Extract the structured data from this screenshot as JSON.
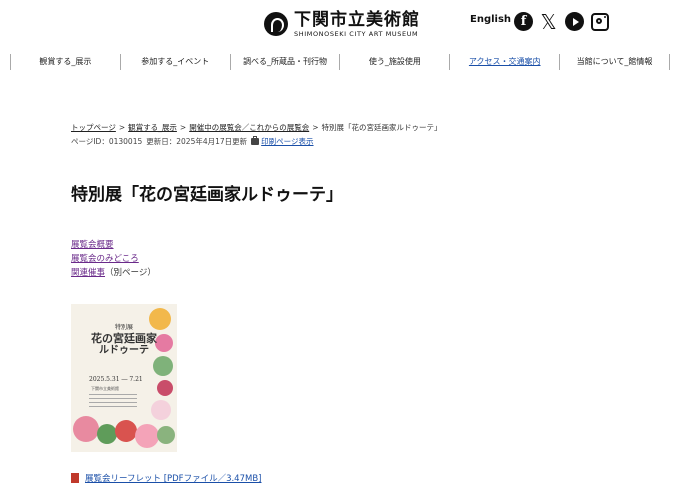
{
  "header": {
    "logo_jp": "下関市立美術館",
    "logo_en": "SHIMONOSEKI CITY ART MUSEUM",
    "language_link": "English",
    "social": [
      "facebook-icon",
      "x-icon",
      "youtube-icon",
      "instagram-icon"
    ]
  },
  "nav": {
    "items": [
      {
        "label": "観賞する_展示"
      },
      {
        "label": "参加する_イベント"
      },
      {
        "label": "調べる_所蔵品・刊行物"
      },
      {
        "label": "使う_施設使用"
      },
      {
        "label": "アクセス・交通案内"
      },
      {
        "label": "当館について_館情報"
      }
    ],
    "active_color": "#1a4fa8"
  },
  "breadcrumb": {
    "items": [
      "トップページ",
      "観賞する_展示",
      "開催中の展覧会／これからの展覧会"
    ],
    "current": "特別展「花の宮廷画家ルドゥーテ」",
    "separator": ">"
  },
  "meta": {
    "page_id": "ページID：0130015",
    "updated": "更新日：2025年4月17日更新",
    "print_label": "印刷ページ表示"
  },
  "page_title": "特別展「花の宮廷画家ルドゥーテ」",
  "anchor_links": {
    "overview": "展覧会概要",
    "highlights": "展覧会のみどころ",
    "related": "関連催事",
    "related_note": "（別ページ）"
  },
  "poster": {
    "line1": "特別展",
    "line2": "花の宮廷画家",
    "line3": "ルドゥーテ",
    "dates": "2025.5.31 ― 7.21",
    "venue": "下関市立美術館"
  },
  "pdf_link": "展覧会リーフレット [PDFファイル／3.47MB]"
}
